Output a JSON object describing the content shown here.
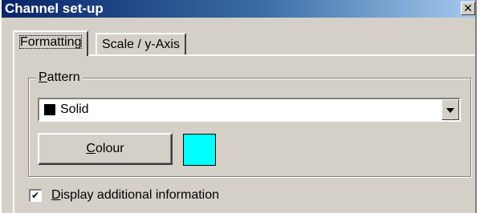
{
  "window": {
    "title": "Channel set-up",
    "close_glyph": "✕",
    "gradient_start": "#0a246a",
    "gradient_end": "#a6caf0"
  },
  "tabs": [
    {
      "label": "Formatting",
      "active": true
    },
    {
      "label": "Scale / y-Axis",
      "active": false
    }
  ],
  "pattern_group": {
    "legend_first": "P",
    "legend_rest": "attern",
    "select": {
      "value": "Solid",
      "swatch_color": "#000000",
      "arrow_icon": "chevron-down-icon"
    }
  },
  "colour": {
    "button_first": "C",
    "button_rest": "olour",
    "swatch_color": "#00ffff"
  },
  "display_info": {
    "checked": true,
    "check_glyph": "✔",
    "label_first": "D",
    "label_rest": "isplay additional information"
  }
}
